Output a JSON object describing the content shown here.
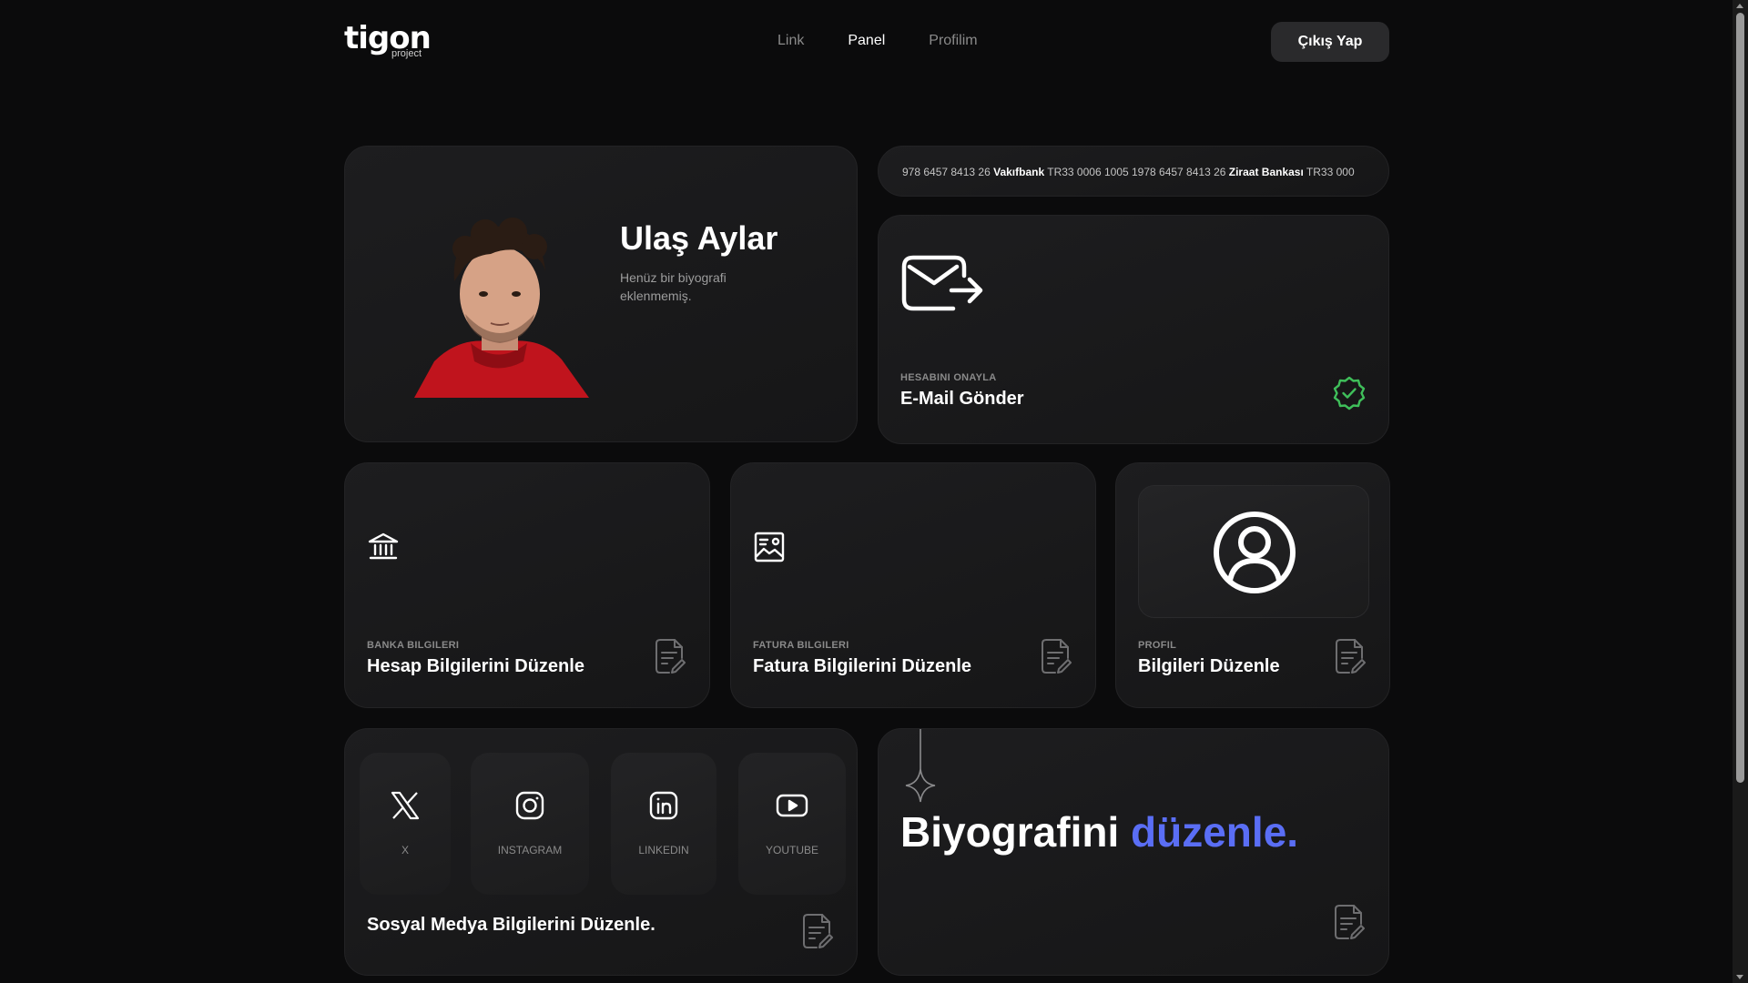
{
  "brand": {
    "logo_text": "tigon",
    "logo_sub": "project"
  },
  "nav": {
    "items": [
      {
        "label": "Link",
        "active": false
      },
      {
        "label": "Panel",
        "active": true
      },
      {
        "label": "Profilim",
        "active": false
      }
    ]
  },
  "header": {
    "logout_label": "Çıkış Yap"
  },
  "profile": {
    "name": "Ulaş Aylar",
    "bio": "Henüz bir biyografi eklenmemiş."
  },
  "iban_ticker": {
    "segments": [
      {
        "text": "978 6457 8413 26 ",
        "bold": false
      },
      {
        "text": "Vakıfbank",
        "bold": true
      },
      {
        "text": " TR33 0006 1005 1978 6457 8413 26 ",
        "bold": false
      },
      {
        "text": "Ziraat Bankası",
        "bold": true
      },
      {
        "text": " TR33 000",
        "bold": false
      }
    ]
  },
  "email_card": {
    "small_label": "HESABINI ONAYLA",
    "title": "E-Mail Gönder",
    "verified_color": "#3fbf5a"
  },
  "bank_card": {
    "small_label": "BANKA BILGILERI",
    "title": "Hesap Bilgilerini Düzenle"
  },
  "invoice_card": {
    "small_label": "FATURA BILGILERI",
    "title": "Fatura Bilgilerini Düzenle"
  },
  "profile_card": {
    "small_label": "PROFIL",
    "title": "Bilgileri Düzenle"
  },
  "social": {
    "tiles": [
      {
        "label": "X",
        "icon": "x-icon"
      },
      {
        "label": "INSTAGRAM",
        "icon": "instagram-icon"
      },
      {
        "label": "LINKEDIN",
        "icon": "linkedin-icon"
      },
      {
        "label": "YOUTUBE",
        "icon": "youtube-icon"
      }
    ],
    "title": "Sosyal Medya Bilgilerini Düzenle."
  },
  "bio_card": {
    "heading_main": "Biyografini",
    "heading_accent": "düzenle.",
    "accent_color": "#5a6ef5"
  }
}
